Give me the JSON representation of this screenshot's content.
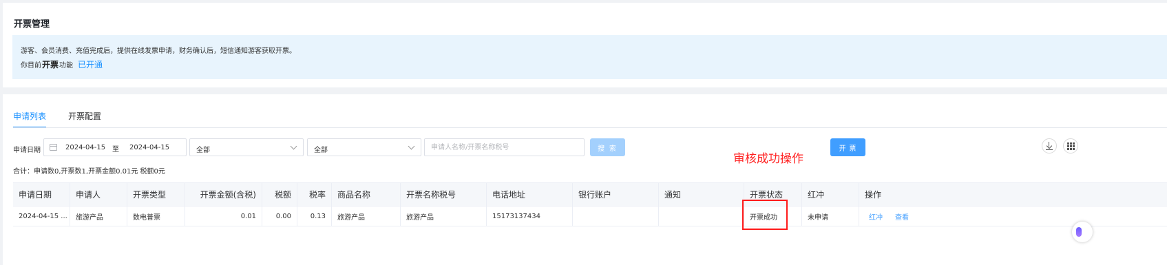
{
  "page": {
    "title": "开票管理"
  },
  "notice": {
    "line1": "游客、会员消费、充值完成后，提供在线发票申请，财务确认后，短信通知游客获取开票。",
    "line2_prefix": "你目前",
    "line2_feature": "开票",
    "line2_suffix": "功能",
    "line2_status": "已开通"
  },
  "tabs": [
    {
      "label": "申请列表",
      "active": true
    },
    {
      "label": "开票配置",
      "active": false
    }
  ],
  "filters": {
    "date_label": "申请日期",
    "date_start": "2024-04-15",
    "date_sep": "至",
    "date_end": "2024-04-15",
    "select1_value": "全部",
    "select2_value": "全部",
    "search_placeholder": "申请人名称/开票名称税号",
    "search_button": "搜 索",
    "invoice_button": "开 票"
  },
  "annotation": "审核成功操作",
  "summary": "合计：申请数0,开票数1,开票金额0.01元 税额0元",
  "table": {
    "headers": [
      "申请日期",
      "申请人",
      "开票类型",
      "开票金额(含税)",
      "税额",
      "税率",
      "商品名称",
      "开票名称税号",
      "电话地址",
      "银行账户",
      "通知",
      "开票状态",
      "红冲",
      "操作"
    ],
    "rows": [
      {
        "date": "2024-04-15 ...",
        "applicant": "旅游产品",
        "type": "数电普票",
        "amount": "0.01",
        "tax": "0.00",
        "rate": "0.13",
        "product": "旅游产品",
        "tax_name": "旅游产品",
        "phone_addr": "15173137434",
        "bank": "",
        "notify": "",
        "status": "开票成功",
        "red": "未申请",
        "action_red": "红冲",
        "action_view": "查看"
      }
    ]
  },
  "colors": {
    "accent": "#409eff",
    "annotation": "#ff2020",
    "notice_bg": "#e8f4fd"
  },
  "icons": [
    "calendar-icon",
    "chevron-down-icon",
    "download-icon",
    "grid-icon"
  ]
}
